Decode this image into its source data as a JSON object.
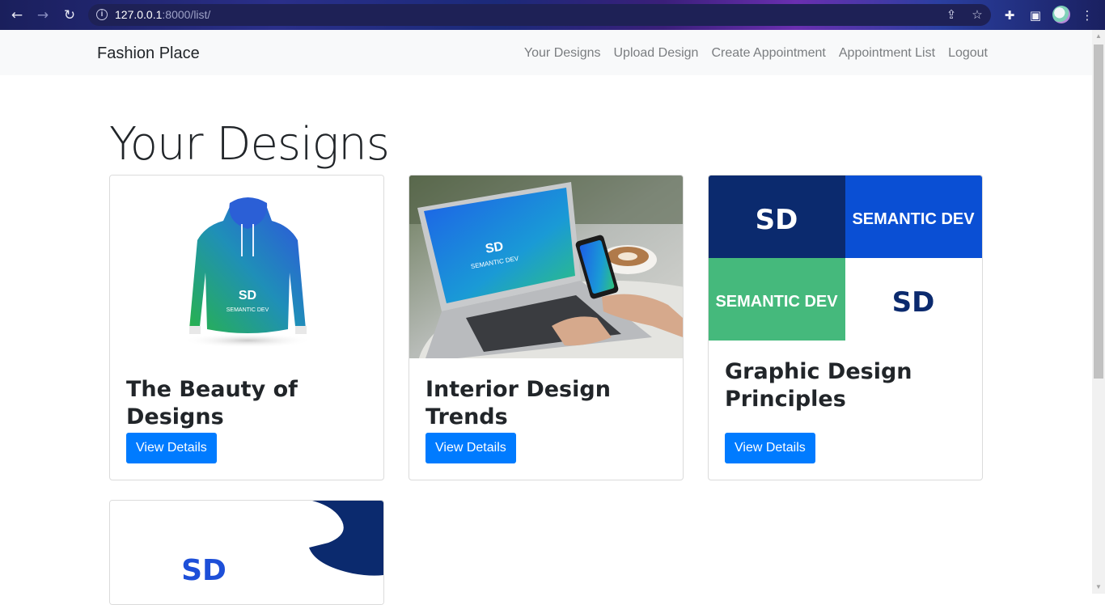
{
  "browser": {
    "url_host": "127.0.0.1",
    "url_rest": ":8000/list/"
  },
  "navbar": {
    "brand": "Fashion Place",
    "links": [
      "Your Designs",
      "Upload Design",
      "Create Appointment",
      "Appointment List",
      "Logout"
    ]
  },
  "page": {
    "title": "Your Designs"
  },
  "designs": [
    {
      "title": "The Beauty of Designs",
      "button": "View Details"
    },
    {
      "title": "Interior Design Trends",
      "button": "View Details"
    },
    {
      "title": "Graphic Design Principles",
      "button": "View Details"
    },
    {
      "title": "",
      "button": ""
    }
  ],
  "images": {
    "tile_text": "SEMANTIC DEV",
    "logo_text": "SD"
  },
  "colors": {
    "primary": "#007bff",
    "navbar_bg": "#f8f9fa",
    "dark_navy": "#0b2a6e",
    "brand_blue": "#0a4fd4",
    "green": "#45b97c"
  }
}
